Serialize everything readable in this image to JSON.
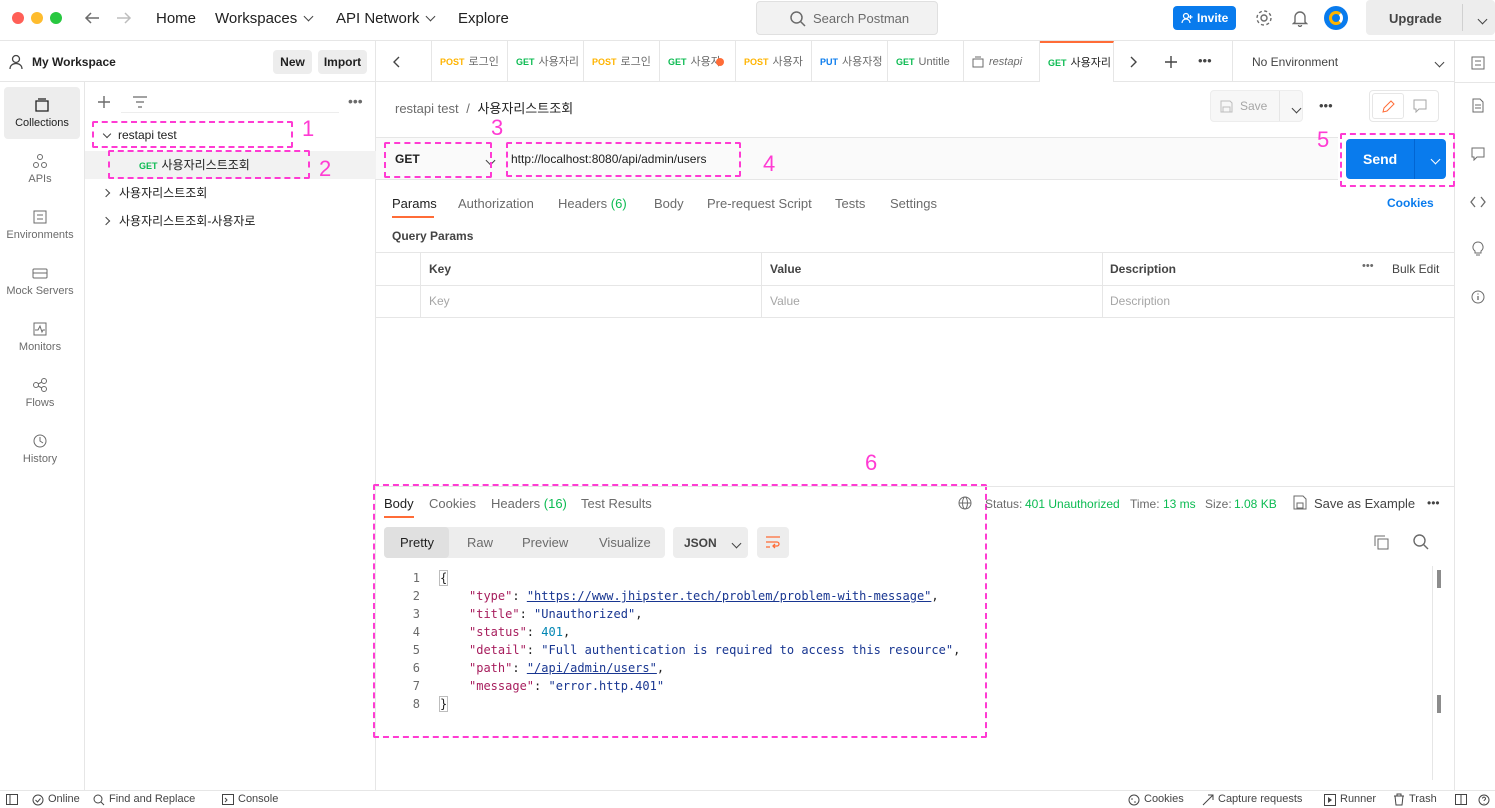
{
  "topbar": {
    "nav": [
      "Home",
      "Workspaces",
      "API Network",
      "Explore"
    ],
    "search_placeholder": "Search Postman",
    "invite": "Invite",
    "upgrade": "Upgrade"
  },
  "workspace": {
    "name": "My Workspace",
    "new_label": "New",
    "import_label": "Import"
  },
  "rail": [
    {
      "label": "Collections",
      "icon": "collections-icon"
    },
    {
      "label": "APIs",
      "icon": "apis-icon"
    },
    {
      "label": "Environments",
      "icon": "environments-icon"
    },
    {
      "label": "Mock Servers",
      "icon": "mock-servers-icon"
    },
    {
      "label": "Monitors",
      "icon": "monitors-icon"
    },
    {
      "label": "Flows",
      "icon": "flows-icon"
    },
    {
      "label": "History",
      "icon": "history-icon"
    }
  ],
  "tree": {
    "collection": "restapi test",
    "request_method": "GET",
    "request_name": "사용자리스트조회",
    "others": [
      "사용자리스트조회",
      "사용자리스트조회-사용자로"
    ]
  },
  "tabs": [
    {
      "method": "",
      "label": ""
    },
    {
      "method": "POST",
      "label": "로그인"
    },
    {
      "method": "GET",
      "label": "사용자리"
    },
    {
      "method": "POST",
      "label": "로그인"
    },
    {
      "method": "GET",
      "label": "사용자"
    },
    {
      "method": "POST",
      "label": "사용자"
    },
    {
      "method": "PUT",
      "label": "사용자정"
    },
    {
      "method": "GET",
      "label": "Untitle"
    },
    {
      "method": "",
      "label": "restapi"
    },
    {
      "method": "GET",
      "label": "사용자리"
    }
  ],
  "environment": "No Environment",
  "breadcrumb": {
    "collection": "restapi test",
    "separator": "/",
    "request": "사용자리스트조회"
  },
  "save_label": "Save",
  "request": {
    "method": "GET",
    "url": "http://localhost:8080/api/admin/users",
    "send": "Send",
    "tabs": [
      "Params",
      "Authorization",
      "Headers",
      "Body",
      "Pre-request Script",
      "Tests",
      "Settings"
    ],
    "headers_count": "(6)",
    "cookies": "Cookies",
    "query_params_title": "Query Params",
    "columns": [
      "Key",
      "Value",
      "Description"
    ],
    "bulk_edit": "Bulk Edit",
    "placeholders": {
      "key": "Key",
      "value": "Value",
      "description": "Description"
    }
  },
  "annotations": [
    "1",
    "2",
    "3",
    "4",
    "5",
    "6"
  ],
  "response": {
    "tabs": [
      "Body",
      "Cookies",
      "Headers",
      "Test Results"
    ],
    "headers_count": "(16)",
    "status_label": "Status:",
    "status_value": "401 Unauthorized",
    "time_label": "Time:",
    "time_value": "13 ms",
    "size_label": "Size:",
    "size_value": "1.08 KB",
    "save_example": "Save as Example",
    "views": [
      "Pretty",
      "Raw",
      "Preview",
      "Visualize"
    ],
    "format": "JSON",
    "lines": [
      "1",
      "2",
      "3",
      "4",
      "5",
      "6",
      "7",
      "8"
    ],
    "body": {
      "open": "{",
      "type_key": "\"type\"",
      "type_val": "\"https://www.jhipster.tech/problem/problem-with-message\"",
      "title_key": "\"title\"",
      "title_val": "\"Unauthorized\"",
      "status_key": "\"status\"",
      "status_val": "401",
      "detail_key": "\"detail\"",
      "detail_val": "\"Full authentication is required to access this resource\"",
      "path_key": "\"path\"",
      "path_val": "\"/api/admin/users\"",
      "message_key": "\"message\"",
      "message_val": "\"error.http.401\"",
      "close": "}"
    }
  },
  "statusbar": {
    "online": "Online",
    "find_replace": "Find and Replace",
    "console": "Console",
    "cookies": "Cookies",
    "capture": "Capture requests",
    "runner": "Runner",
    "trash": "Trash"
  },
  "colors": {
    "accent": "#ff6c37",
    "primary": "#097bed",
    "get": "#0cbb52",
    "post": "#ffb400",
    "put": "#097bed",
    "annotation": "#ff3bd3"
  }
}
